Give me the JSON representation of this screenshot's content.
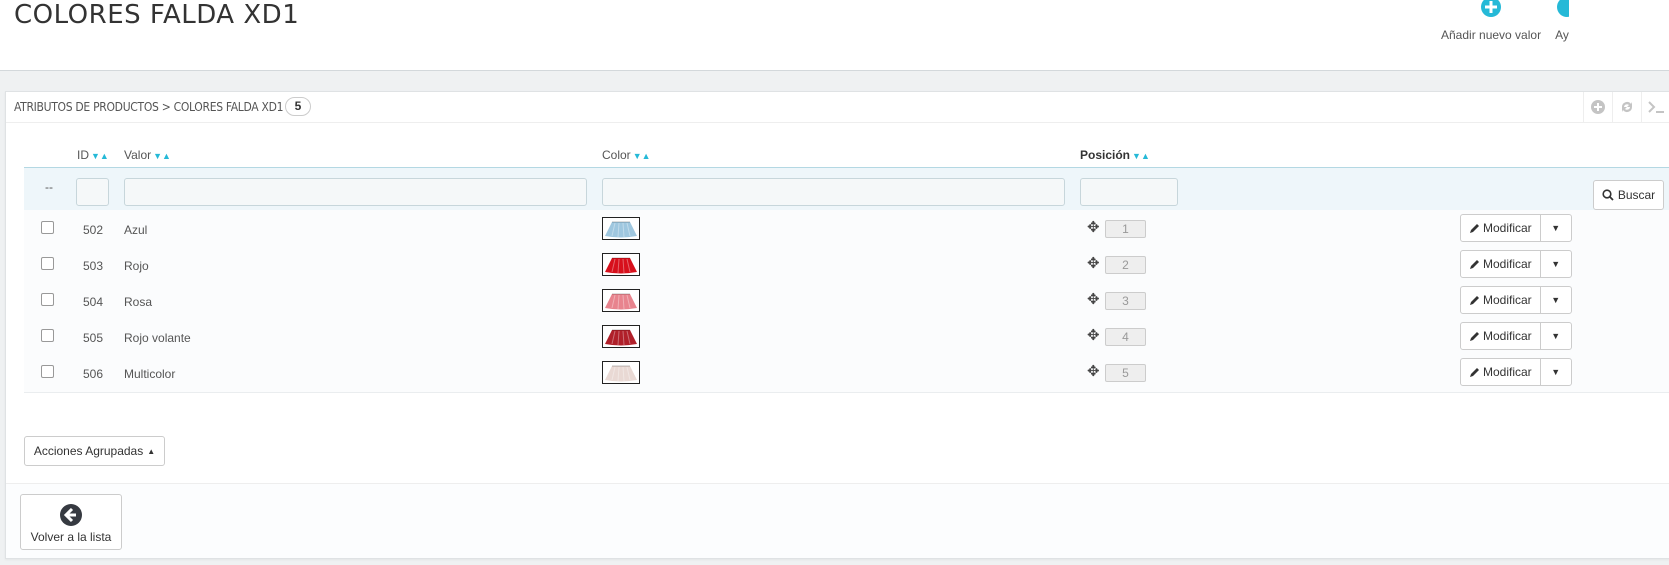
{
  "header": {
    "title": "COLORES FALDA XD1",
    "toolbar": [
      {
        "label": "Añadir nuevo valor",
        "icon": "plus-circle-icon"
      },
      {
        "label": "Ay",
        "icon": "help-circle-icon"
      }
    ]
  },
  "panel": {
    "breadcrumb": "ATRIBUTOS DE PRODUCTOS > COLORES FALDA XD1",
    "count": "5",
    "heading_icons": [
      "add-icon",
      "refresh-icon",
      "sql-terminal-icon"
    ]
  },
  "table": {
    "columns": {
      "id": "ID",
      "value": "Valor",
      "color": "Color",
      "position": "Posición"
    },
    "filter_placeholder_dash": "--",
    "search_label": "Buscar",
    "rows": [
      {
        "id": "502",
        "value": "Azul",
        "position": "1",
        "swatch": "#9fc7df"
      },
      {
        "id": "503",
        "value": "Rojo",
        "position": "2",
        "swatch": "#d7101c"
      },
      {
        "id": "504",
        "value": "Rosa",
        "position": "3",
        "swatch": "#e8848e"
      },
      {
        "id": "505",
        "value": "Rojo volante",
        "position": "4",
        "swatch": "#b0202a"
      },
      {
        "id": "506",
        "value": "Multicolor",
        "position": "5",
        "swatch": "#e9d9d4"
      }
    ],
    "edit_label": "Modificar"
  },
  "bulk_actions_label": "Acciones Agrupadas",
  "back_label": "Volver a la lista",
  "colors": {
    "accent": "#25b9d7"
  }
}
